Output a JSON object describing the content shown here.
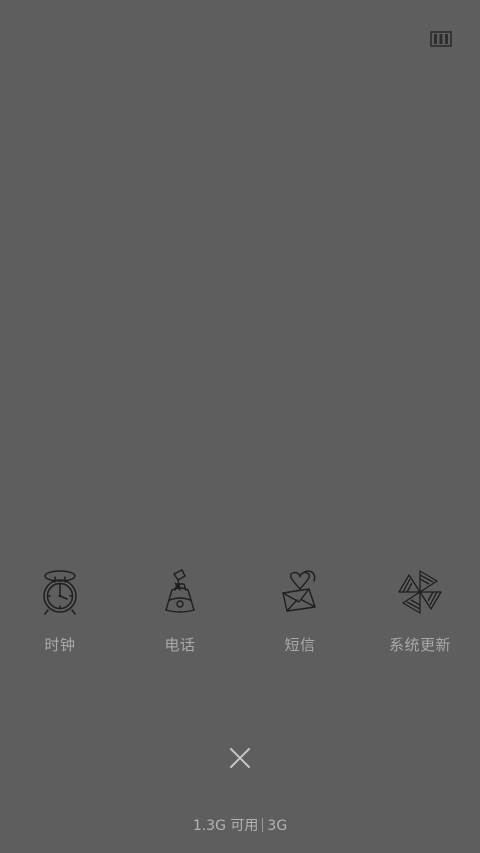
{
  "header": {
    "view_toggle_icon": "grid-view-icon"
  },
  "apps": [
    {
      "label": "时钟",
      "icon": "alarm-clock-icon"
    },
    {
      "label": "电话",
      "icon": "phone-icon"
    },
    {
      "label": "短信",
      "icon": "message-icon"
    },
    {
      "label": "系统更新",
      "icon": "pinwheel-icon"
    }
  ],
  "footer": {
    "close_icon": "close-icon",
    "memory_available": "1.3G 可用",
    "memory_total": "3G"
  },
  "colors": {
    "background": "#5e5e5e",
    "label": "#a9a9a9",
    "icon_stroke": "#1f1f1f"
  }
}
